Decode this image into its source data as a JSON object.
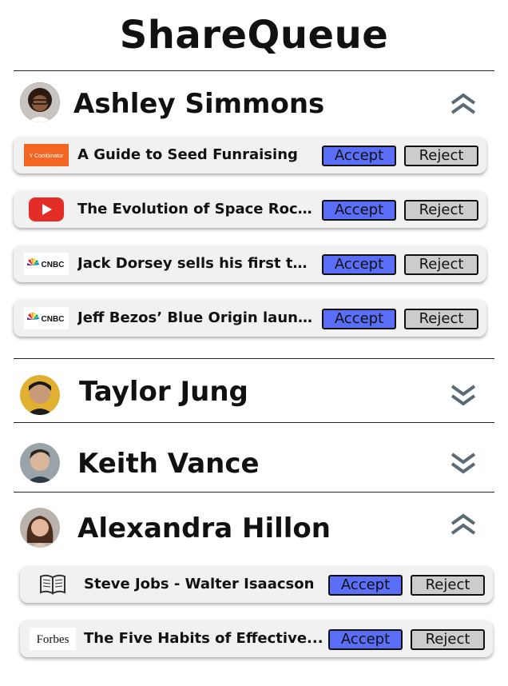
{
  "app": {
    "title": "ShareQueue"
  },
  "colors": {
    "accent": "#5b6ef7",
    "reject": "#cccccc",
    "chevron": "#5a6b78"
  },
  "users": [
    {
      "name": "Ashley Simmons",
      "expanded": true,
      "avatar": "avatar-photo",
      "items": [
        {
          "source": "Y Combinator",
          "icon": "ycombinator-logo-icon",
          "title": "A Guide to Seed Funraising",
          "accept": "Accept",
          "reject": "Reject"
        },
        {
          "source": "YouTube",
          "icon": "youtube-logo-icon",
          "title": "The Evolution of Space Rock...",
          "accept": "Accept",
          "reject": "Reject"
        },
        {
          "source": "CNBC",
          "icon": "cnbc-logo-icon",
          "title": "Jack Dorsey sells his first tw...",
          "accept": "Accept",
          "reject": "Reject"
        },
        {
          "source": "CNBC",
          "icon": "cnbc-logo-icon",
          "title": "Jeff Bezos’ Blue Origin launc...",
          "accept": "Accept",
          "reject": "Reject"
        }
      ]
    },
    {
      "name": "Taylor Jung",
      "expanded": false,
      "avatar": "avatar-photo",
      "items": []
    },
    {
      "name": "Keith Vance",
      "expanded": false,
      "avatar": "avatar-photo",
      "items": []
    },
    {
      "name": "Alexandra Hillon",
      "expanded": true,
      "avatar": "avatar-photo",
      "items": [
        {
          "source": "Book",
          "icon": "book-icon",
          "title": "Steve Jobs - Walter Isaacson",
          "accept": "Accept",
          "reject": "Reject"
        },
        {
          "source": "Forbes",
          "icon": "forbes-logo-icon",
          "title": "The Five Habits of Effective...",
          "accept": "Accept",
          "reject": "Reject"
        }
      ]
    }
  ]
}
